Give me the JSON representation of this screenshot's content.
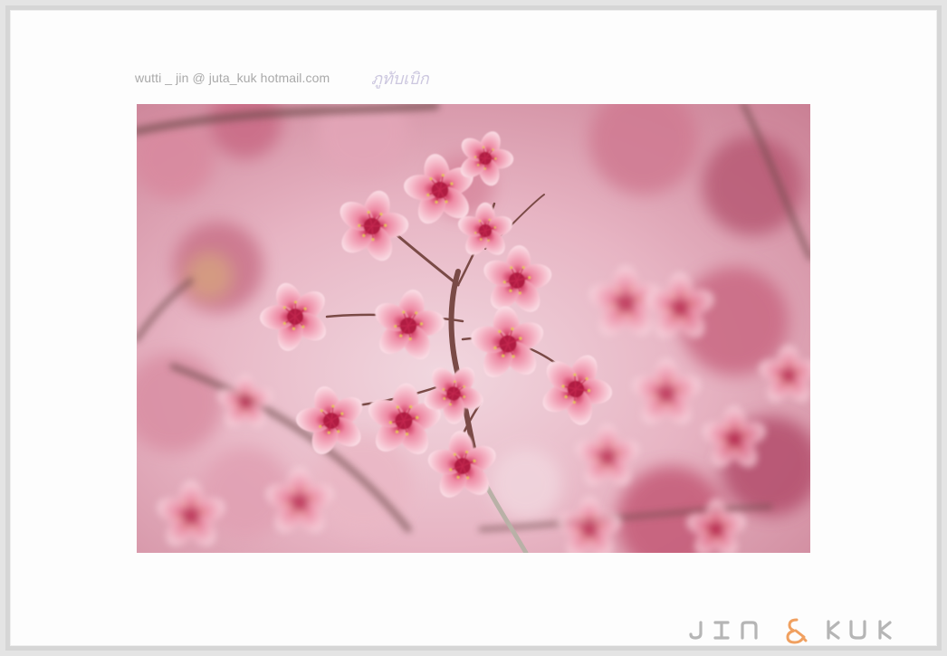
{
  "caption": {
    "email": "wutti _ jin @  juta_kuk  hotmail.com",
    "thai_credit": "ภูทับเบิก"
  },
  "photo": {
    "subject": "cherry-blossom-photo",
    "colors": {
      "blossom": "#e0607f",
      "blossom_light": "#f5c8d4",
      "blossom_deep": "#b3314f",
      "background": "#e7b2c1",
      "branch": "#6a4b46"
    }
  },
  "signature": {
    "text": "JIN & KUK",
    "color": "#b5b5b5",
    "accent": "#f0a060"
  }
}
